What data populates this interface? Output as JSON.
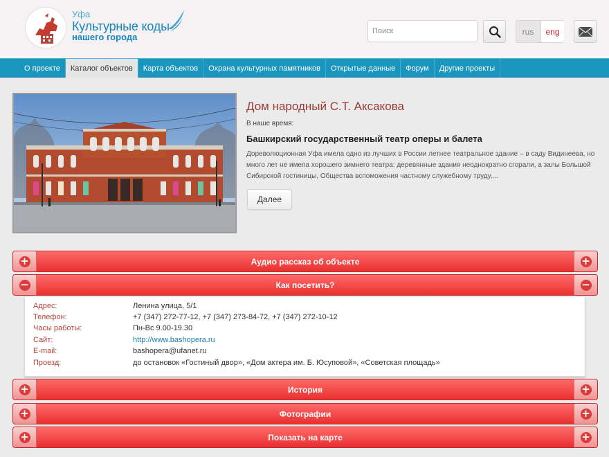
{
  "header": {
    "city": "Уфа",
    "title": "Культурные коды",
    "subtitle": "нашего города",
    "search_placeholder": "Поиск",
    "lang_rus": "rus",
    "lang_eng": "eng"
  },
  "nav": {
    "items": [
      "О проекте",
      "Каталог объектов",
      "Карта объектов",
      "Охрана культурных памятников",
      "Открытые данные",
      "Форум",
      "Другие проекты"
    ],
    "active_index": 1
  },
  "object": {
    "title": "Дом народный С.Т. Аксакова",
    "era_label": "В наше время:",
    "modern_name": "Башкирский государственный театр оперы и балета",
    "description": "Дореволюционная Уфа имела одно из лучших в России летнее театральное здание – в саду Видинеева, но много лет не имела хорошего зимнего театра: деревянные здания неоднократно сгорали, а залы Большой Сибирской гостиницы, Общества вспоможения частному служебному труду,...",
    "more_label": "Далее"
  },
  "accordion": {
    "audio": "Аудио рассказ об объекте",
    "visit": "Как посетить?",
    "history": "История",
    "photos": "Фотографии",
    "map": "Показать на карте"
  },
  "visit": {
    "address_label": "Адрес:",
    "address": "Ленина улица, 5/1",
    "phone_label": "Телефон:",
    "phone": "+7 (347) 272-77-12, +7 (347) 273-84-72, +7 (347) 272-10-12",
    "hours_label": "Часы работы:",
    "hours": "Пн-Вс 9.00-19.30",
    "site_label": "Сайт:",
    "site": "http://www.bashopera.ru",
    "email_label": "E-mail:",
    "email": "bashopera@ufanet.ru",
    "transit_label": "Проезд:",
    "transit": "до остановок «Гостиный двор», «Дом актера им. Б. Юсуповой», «Советская площадь»"
  },
  "colors": {
    "accent_red": "#e8302f",
    "nav_blue": "#1a96be",
    "title_red": "#9a3935",
    "logo_blue": "#1786be"
  }
}
